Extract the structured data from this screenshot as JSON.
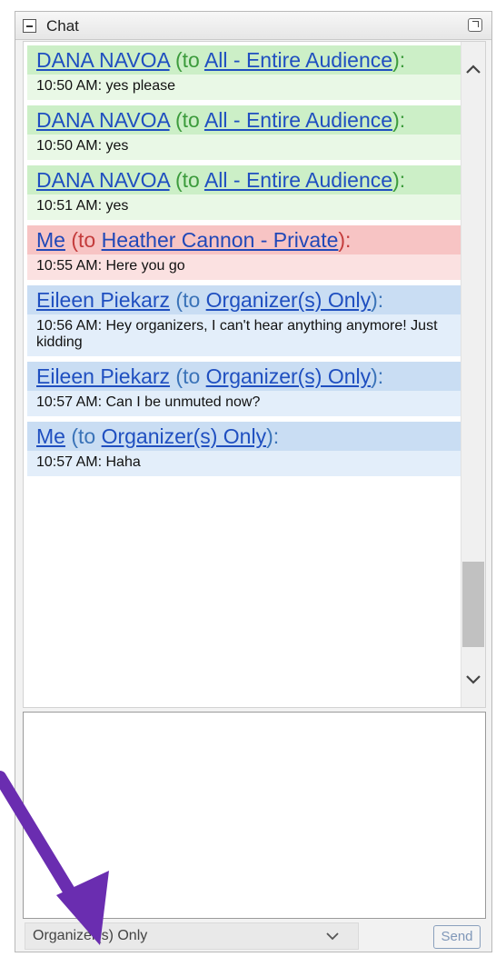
{
  "header": {
    "title": "Chat",
    "collapse_icon": "minus-box-icon",
    "popout_icon": "popout-icon"
  },
  "messages": [
    {
      "color": "green",
      "sender": "DANA NAVOA",
      "to_prefix": " (to ",
      "recipient": "All - Entire Audience",
      "to_suffix": "):",
      "text": "10:50 AM: yes please"
    },
    {
      "color": "green",
      "sender": "DANA NAVOA",
      "to_prefix": " (to ",
      "recipient": "All - Entire Audience",
      "to_suffix": "):",
      "text": "10:50 AM: yes"
    },
    {
      "color": "green",
      "sender": "DANA NAVOA",
      "to_prefix": " (to ",
      "recipient": "All - Entire Audience",
      "to_suffix": "):",
      "text": "10:51 AM: yes"
    },
    {
      "color": "red",
      "sender": "Me",
      "to_prefix": " (to ",
      "recipient": "Heather Cannon - Private",
      "to_suffix": "):",
      "text": "10:55 AM: Here you go"
    },
    {
      "color": "blue",
      "sender": "Eileen Piekarz",
      "to_prefix": " (to ",
      "recipient": "Organizer(s) Only",
      "to_suffix": "):",
      "text": "10:56 AM: Hey organizers, I can't hear anything anymore!  Just kidding"
    },
    {
      "color": "blue",
      "sender": "Eileen Piekarz",
      "to_prefix": " (to ",
      "recipient": "Organizer(s) Only",
      "to_suffix": "):",
      "text": "10:57 AM: Can I be unmuted now?"
    },
    {
      "color": "blue",
      "sender": "Me",
      "to_prefix": " (to ",
      "recipient": "Organizer(s) Only",
      "to_suffix": "):",
      "text": "10:57 AM: Haha"
    }
  ],
  "input": {
    "value": ""
  },
  "recipient_select": {
    "selected": "Organizer(s) Only"
  },
  "send_button": {
    "label": "Send"
  },
  "colors": {
    "arrow": "#6a2db0",
    "green_head": "#ccefc7",
    "red_head": "#f7c4c4",
    "blue_head": "#c9ddf3"
  }
}
